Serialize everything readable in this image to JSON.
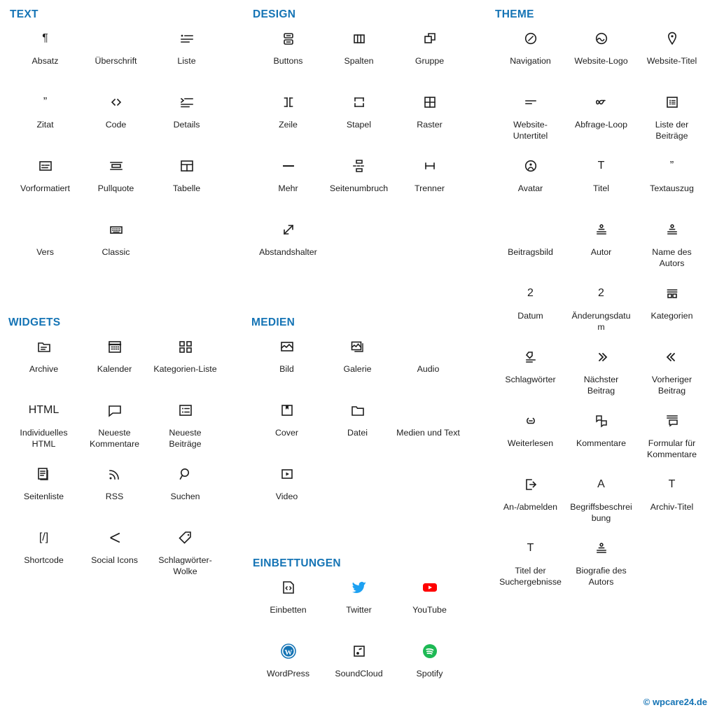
{
  "footer": {
    "text": "© wpcare24.de"
  },
  "panels": [
    {
      "id": "text",
      "title": "TEXT",
      "items": [
        {
          "label": "Absatz",
          "icon": "paragraph-pilcrow-icon"
        },
        {
          "label": "Überschrift",
          "icon": "heading-bookmark-icon"
        },
        {
          "label": "Liste",
          "icon": "list-bullets-icon"
        },
        {
          "label": "Zitat",
          "icon": "quote-marks-icon"
        },
        {
          "label": "Code",
          "icon": "code-angle-brackets-icon"
        },
        {
          "label": "Details",
          "icon": "details-lines-icon"
        },
        {
          "label": "Vorformatiert",
          "icon": "preformatted-box-icon"
        },
        {
          "label": "Pullquote",
          "icon": "pullquote-bars-icon"
        },
        {
          "label": "Tabelle",
          "icon": "table-grid-icon"
        },
        {
          "label": "Vers",
          "icon": "verse-quill-icon"
        },
        {
          "label": "Classic",
          "icon": "classic-keyboard-icon"
        }
      ]
    },
    {
      "id": "widgets",
      "title": "WIDGETS",
      "items": [
        {
          "label": "Archive",
          "icon": "archive-folder-icon"
        },
        {
          "label": "Kalender",
          "icon": "calendar-icon"
        },
        {
          "label": "Kategorien-Liste",
          "icon": "categories-squares-icon"
        },
        {
          "label": "Individuelles HTML",
          "icon": "html-text-icon"
        },
        {
          "label": "Neueste Kommentare",
          "icon": "comment-bubble-icon"
        },
        {
          "label": "Neueste Beiträge",
          "icon": "posts-list-box-icon"
        },
        {
          "label": "Seitenliste",
          "icon": "page-list-stack-icon"
        },
        {
          "label": "RSS",
          "icon": "rss-waves-icon"
        },
        {
          "label": "Suchen",
          "icon": "search-magnifier-icon"
        },
        {
          "label": "Shortcode",
          "icon": "shortcode-bracket-slash-icon"
        },
        {
          "label": "Social Icons",
          "icon": "share-nodes-icon"
        },
        {
          "label": "Schlagwörter-Wolke",
          "icon": "tag-cloud-icon"
        }
      ]
    },
    {
      "id": "design",
      "title": "DESIGN",
      "items": [
        {
          "label": "Buttons",
          "icon": "buttons-stacked-icon"
        },
        {
          "label": "Spalten",
          "icon": "columns-icon"
        },
        {
          "label": "Gruppe",
          "icon": "group-overlap-icon"
        },
        {
          "label": "Zeile",
          "icon": "row-brackets-icon"
        },
        {
          "label": "Stapel",
          "icon": "stack-icon"
        },
        {
          "label": "Raster",
          "icon": "grid-four-icon"
        },
        {
          "label": "Mehr",
          "icon": "more-dashes-icon"
        },
        {
          "label": "Seitenumbruch",
          "icon": "page-break-icon"
        },
        {
          "label": "Trenner",
          "icon": "separator-hbar-icon"
        },
        {
          "label": "Abstandshalter",
          "icon": "spacer-diagonal-arrow-icon"
        }
      ]
    },
    {
      "id": "medien",
      "title": "MEDIEN",
      "items": [
        {
          "label": "Bild",
          "icon": "image-icon"
        },
        {
          "label": "Galerie",
          "icon": "gallery-stack-icon"
        },
        {
          "label": "Audio",
          "icon": "audio-note-icon"
        },
        {
          "label": "Cover",
          "icon": "cover-bookmark-icon"
        },
        {
          "label": "Datei",
          "icon": "file-folder-icon"
        },
        {
          "label": "Medien und Text",
          "icon": "media-text-icon"
        },
        {
          "label": "Video",
          "icon": "video-play-icon"
        }
      ]
    },
    {
      "id": "embeds",
      "title": "EINBETTUNGEN",
      "items": [
        {
          "label": "Einbetten",
          "icon": "embed-code-icon"
        },
        {
          "label": "Twitter",
          "icon": "twitter-bird-icon",
          "color": "#1da1f2"
        },
        {
          "label": "YouTube",
          "icon": "youtube-icon",
          "color": "#ff0000"
        },
        {
          "label": "WordPress",
          "icon": "wordpress-icon",
          "color": "#1574b5"
        },
        {
          "label": "SoundCloud",
          "icon": "soundcloud-note-icon"
        },
        {
          "label": "Spotify",
          "icon": "spotify-icon",
          "color": "#1db954"
        }
      ]
    },
    {
      "id": "theme",
      "title": "THEME",
      "items": [
        {
          "label": "Navigation",
          "icon": "navigation-compass-icon"
        },
        {
          "label": "Website-Logo",
          "icon": "site-logo-icon"
        },
        {
          "label": "Website-Titel",
          "icon": "site-title-pin-icon"
        },
        {
          "label": "Website-Untertitel",
          "icon": "site-tagline-icon"
        },
        {
          "label": "Abfrage-Loop",
          "icon": "query-loop-icon"
        },
        {
          "label": "Liste der Beiträge",
          "icon": "post-list-icon"
        },
        {
          "label": "Avatar",
          "icon": "avatar-icon"
        },
        {
          "label": "Titel",
          "icon": "post-title-icon"
        },
        {
          "label": "Textauszug",
          "icon": "excerpt-quote-icon"
        },
        {
          "label": "Beitragsbild",
          "icon": "featured-image-icon"
        },
        {
          "label": "Autor",
          "icon": "author-icon"
        },
        {
          "label": "Name des Autors",
          "icon": "author-name-icon"
        },
        {
          "label": "Datum",
          "icon": "date-calendar-icon"
        },
        {
          "label": "Änderungsdatum",
          "icon": "modified-date-icon"
        },
        {
          "label": "Kategorien",
          "icon": "terms-categories-icon"
        },
        {
          "label": "Schlagwörter",
          "icon": "post-tags-icon"
        },
        {
          "label": "Nächster Beitrag",
          "icon": "next-post-chevrons-icon"
        },
        {
          "label": "Vorheriger Beitrag",
          "icon": "previous-post-chevrons-icon"
        },
        {
          "label": "Weiterlesen",
          "icon": "read-more-link-icon"
        },
        {
          "label": "Kommentare",
          "icon": "comments-icon"
        },
        {
          "label": "Formular für Kommentare",
          "icon": "comment-form-icon"
        },
        {
          "label": "An-/abmelden",
          "icon": "login-logout-icon"
        },
        {
          "label": "Begriffsbeschreibung",
          "icon": "term-description-icon"
        },
        {
          "label": "Archiv-Titel",
          "icon": "archive-title-icon"
        },
        {
          "label": "Titel der Suchergebnisse",
          "icon": "search-results-title-icon"
        },
        {
          "label": "Biografie des Autors",
          "icon": "author-biography-icon"
        }
      ]
    }
  ]
}
